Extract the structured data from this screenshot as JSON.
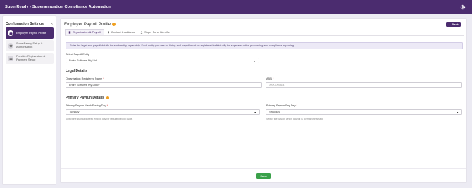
{
  "app": {
    "title": "SuperReady - Superannuation Compliance Automation"
  },
  "sidebar": {
    "title": "Configuration Settings",
    "items": [
      {
        "label": "Employer Payroll Profile",
        "active": true,
        "icon": "briefcase-icon"
      },
      {
        "label": "SuperReady Setup & Authorisation",
        "active": false,
        "icon": "shield-icon"
      },
      {
        "label": "Provider Registration & Payment Setup",
        "active": false,
        "icon": "card-icon"
      }
    ]
  },
  "header": {
    "title": "Employer Payroll Profile",
    "back_label": "← Back"
  },
  "tabs": [
    {
      "label": "Organisation & Payroll",
      "active": true,
      "icon": "building-icon"
    },
    {
      "label": "Contact & Address",
      "active": false,
      "icon": "location-pin-icon"
    },
    {
      "label": "Super Fund Identifier",
      "active": false,
      "icon": "user-icon"
    }
  ],
  "notice": {
    "text": "Enter the legal and payroll details for each entity separately. Each entity you use for hiring and payroll must be registered individually for superannuation processing and compliance reporting."
  },
  "entity": {
    "label": "Select Payroll Entity",
    "value": "Entire Software Pty Ltd"
  },
  "legal": {
    "title": "Legal Details",
    "org_label": "Organisation Registered Name",
    "org_value": "Entire Software Pty Ltd v7",
    "abn_label": "ABN",
    "abn_value": "XXXXXX884"
  },
  "payrun": {
    "title": "Primary Payrun Details",
    "week_label": "Primary Payrun Week Ending Day",
    "week_value": "Tuesday",
    "week_hint": "Select the standard week ending day for regular payroll cycle.",
    "pay_label": "Primary Payrun Pay Day",
    "pay_value": "Saturday",
    "pay_hint": "Select the day on which payroll is normally finalised."
  },
  "footer": {
    "save_label": "Save"
  },
  "colors": {
    "brand": "#4b2c6f",
    "save": "#3aa14a",
    "info": "#f0a020"
  }
}
